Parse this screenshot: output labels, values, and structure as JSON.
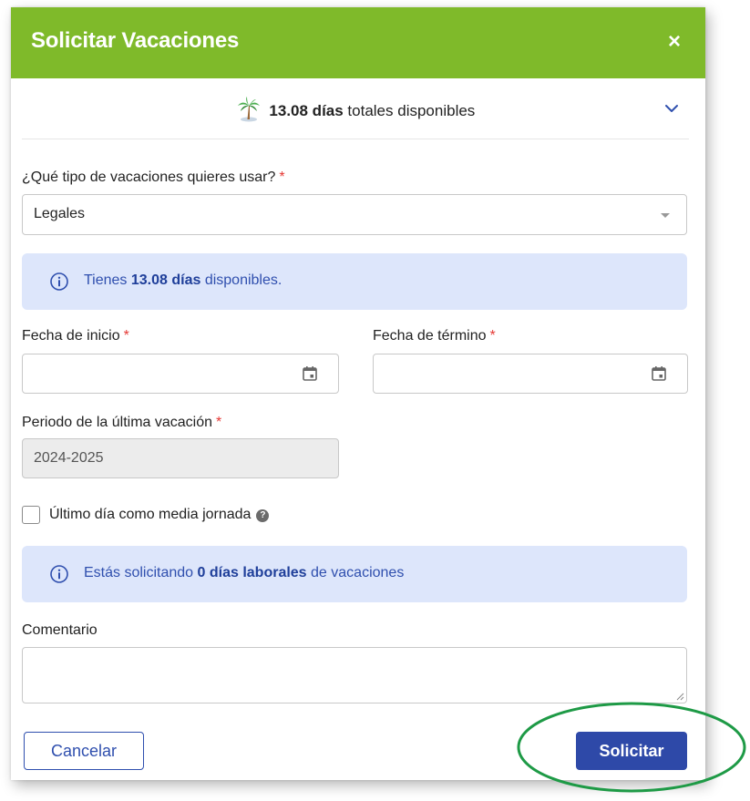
{
  "header": {
    "title": "Solicitar Vacaciones",
    "close_label": "×"
  },
  "summary": {
    "days": "13.08 días",
    "suffix": " totales disponibles",
    "icon": "palm-tree-icon"
  },
  "form": {
    "vacation_type_label": "¿Qué tipo de vacaciones quieres usar?",
    "vacation_type_value": "Legales",
    "available_alert": {
      "prefix": "Tienes ",
      "bold": "13.08 días",
      "suffix": " disponibles."
    },
    "start_date_label": "Fecha de inicio",
    "end_date_label": "Fecha de término",
    "period_label": "Periodo de la última vacación",
    "period_value": "2024-2025",
    "half_day_label": "Último día como media jornada",
    "requesting_alert": {
      "prefix": "Estás solicitando ",
      "bold": "0 días laborales",
      "suffix": " de vacaciones"
    },
    "comment_label": "Comentario",
    "required_mark": "*"
  },
  "footer": {
    "cancel_label": "Cancelar",
    "submit_label": "Solicitar"
  },
  "colors": {
    "header": "#7fba2a",
    "primary": "#2e49a8",
    "alert_bg": "#dde6fb",
    "required": "#e53935",
    "highlight_ring": "#1e9a46"
  }
}
